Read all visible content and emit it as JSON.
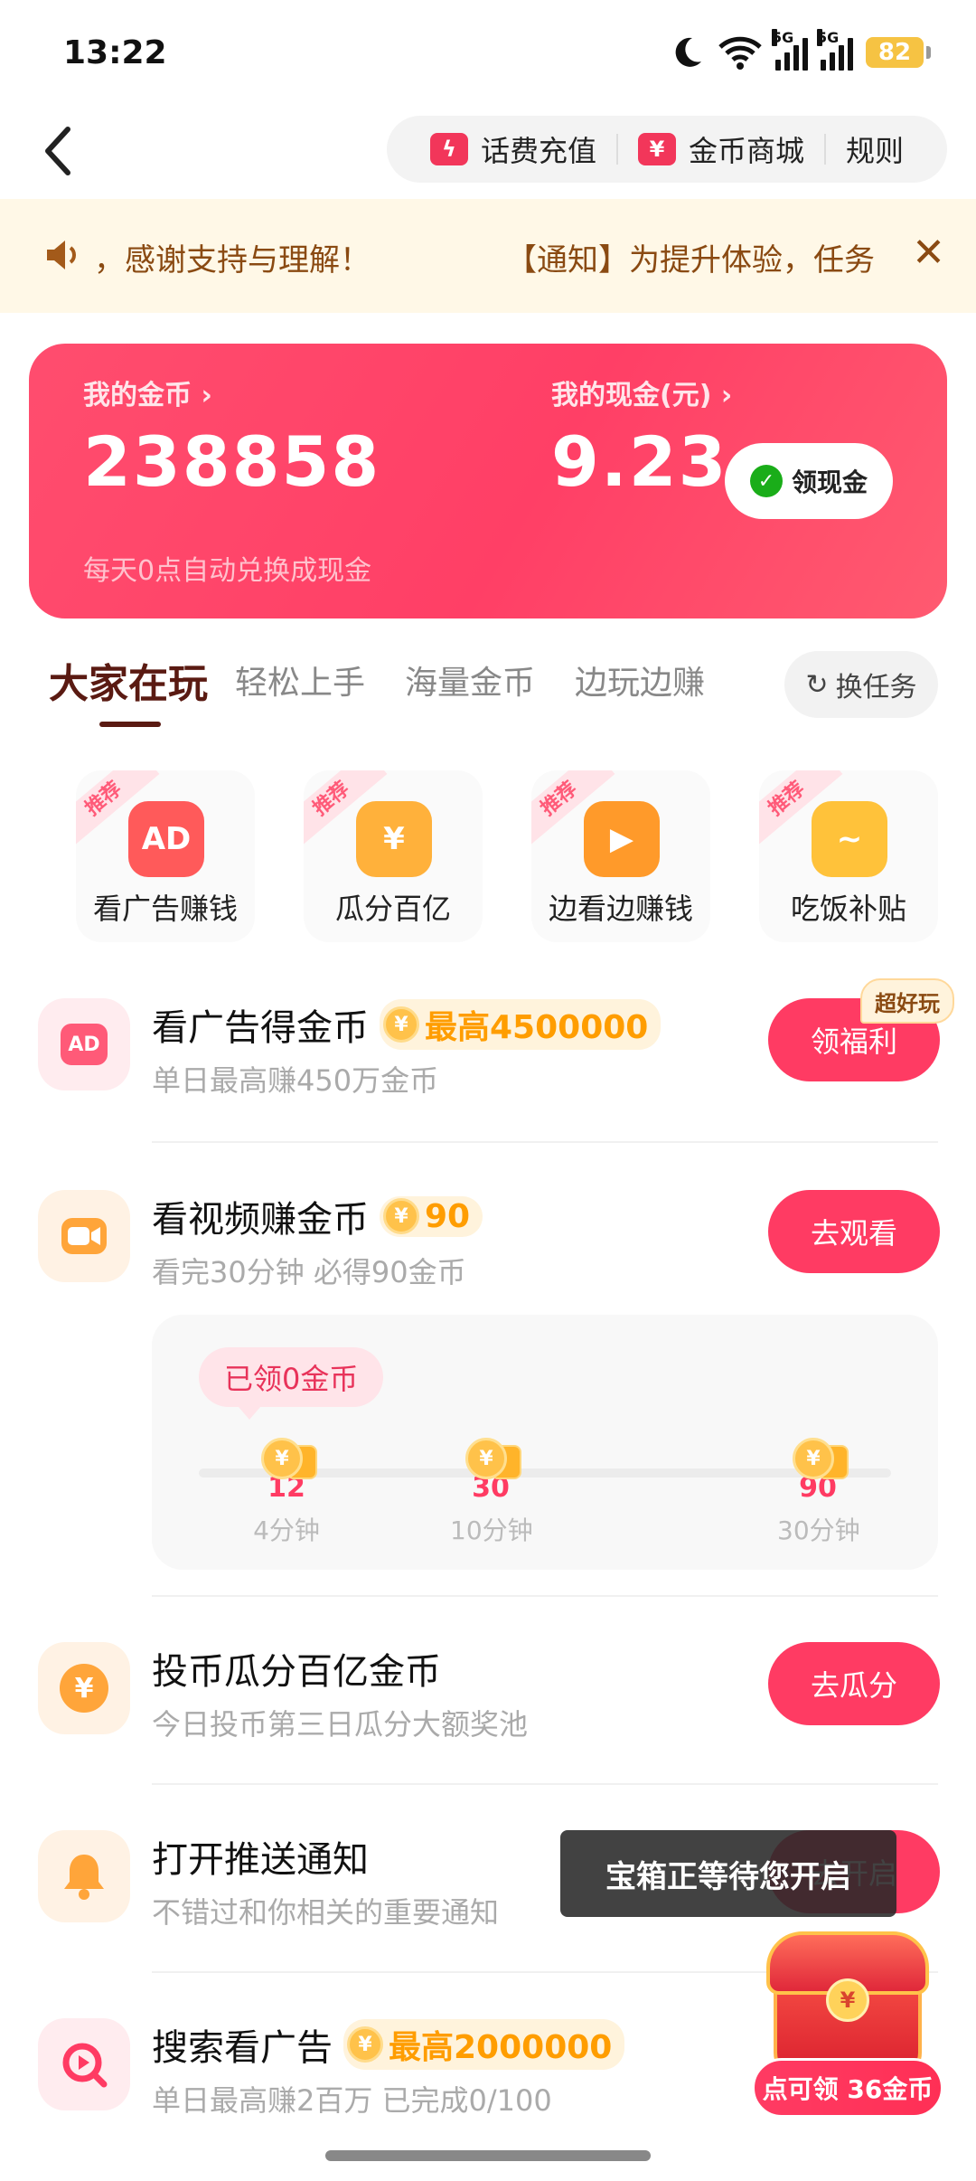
{
  "status_bar": {
    "time": "13:22",
    "network1": "5G",
    "network2": "5G",
    "battery": "82"
  },
  "header": {
    "back_icon": "chevron-left-icon",
    "links": [
      {
        "label": "话费充值",
        "icon": "lightning-icon"
      },
      {
        "label": "金币商城",
        "icon": "ticket-icon"
      },
      {
        "label": "规则"
      }
    ]
  },
  "notice": {
    "text": "，感谢支持与理解！",
    "text2": "【通知】为提升体验，任务"
  },
  "coin_card": {
    "coins_label": "我的金币 ›",
    "coins_value": "238858",
    "coins_sub": "每天0点自动兑换成现金",
    "cash_label": "我的现金(元) ›",
    "cash_value": "9.23",
    "cash_button": "领现金"
  },
  "tabs": {
    "items": [
      "大家在玩",
      "轻松上手",
      "海量金币",
      "边玩边赚"
    ],
    "active_index": 0,
    "swap_button": "换任务"
  },
  "quick_items": [
    {
      "ribbon": "推荐",
      "label": "看广告赚钱",
      "icon_text": "AD",
      "color": "#ff5a5a"
    },
    {
      "ribbon": "推荐",
      "label": "瓜分百亿",
      "icon_text": "¥",
      "color": "#ffb13b"
    },
    {
      "ribbon": "推荐",
      "label": "边看边赚钱",
      "icon_text": "▶",
      "color": "#ff9a2a"
    },
    {
      "ribbon": "推荐",
      "label": "吃饭补贴",
      "icon_text": "~",
      "color": "#ffc23a"
    }
  ],
  "tasks": {
    "ad": {
      "title": "看广告得金币",
      "badge": "最高4500000",
      "sub": "单日最高赚450万金币",
      "button": "领福利",
      "hot_tag": "超好玩",
      "icon_text": "AD"
    },
    "video": {
      "title": "看视频赚金币",
      "badge": "90",
      "sub": "看完30分钟 必得90金币",
      "button": "去观看"
    },
    "coin_pool": {
      "title": "投币瓜分百亿金币",
      "sub": "今日投币第三日瓜分大额奖池",
      "button": "去瓜分",
      "icon_text": "¥"
    },
    "push": {
      "title": "打开推送通知",
      "sub": "不错过和你相关的重要通知",
      "button": "去开启"
    },
    "search": {
      "title": "搜索看广告",
      "badge": "最高2000000",
      "sub": "单日最高赚2百万 已完成0/100"
    }
  },
  "video_progress": {
    "claimed": "已领0金币",
    "milestones": [
      {
        "value": "12",
        "label": "4分钟"
      },
      {
        "value": "30",
        "label": "10分钟"
      },
      {
        "value": "90",
        "label": "30分钟"
      }
    ]
  },
  "toast": "宝箱正等待您开启",
  "chest": {
    "tag": "点可领 36金币",
    "lock": "¥"
  }
}
